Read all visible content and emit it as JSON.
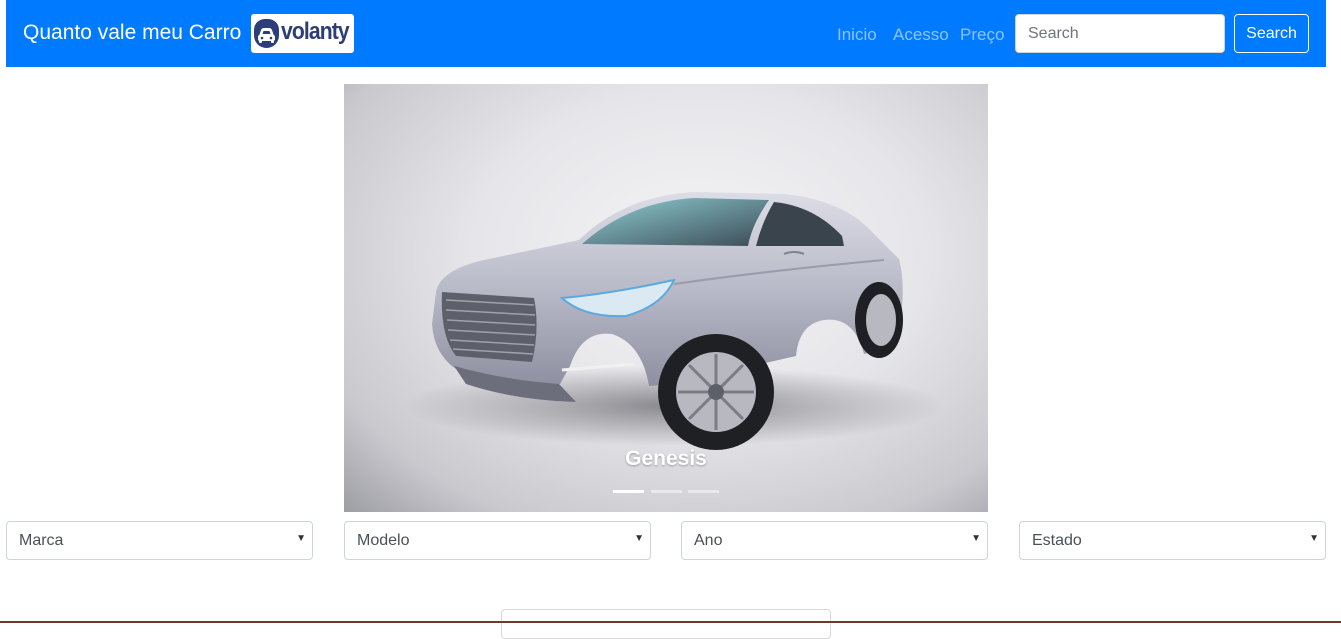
{
  "navbar": {
    "brand": "Quanto vale meu Carro",
    "logo_text": "volanty",
    "links": [
      "Inicio",
      "Acesso",
      "Preço"
    ],
    "search_placeholder": "Search",
    "search_button": "Search"
  },
  "carousel": {
    "caption": "Genesis",
    "slide_count": 3,
    "active_slide": 1
  },
  "filters": {
    "marca": "Marca",
    "modelo": "Modelo",
    "ano": "Ano",
    "estado": "Estado"
  },
  "colors": {
    "navbar": "#007bff",
    "logo": "#2d3d78"
  }
}
